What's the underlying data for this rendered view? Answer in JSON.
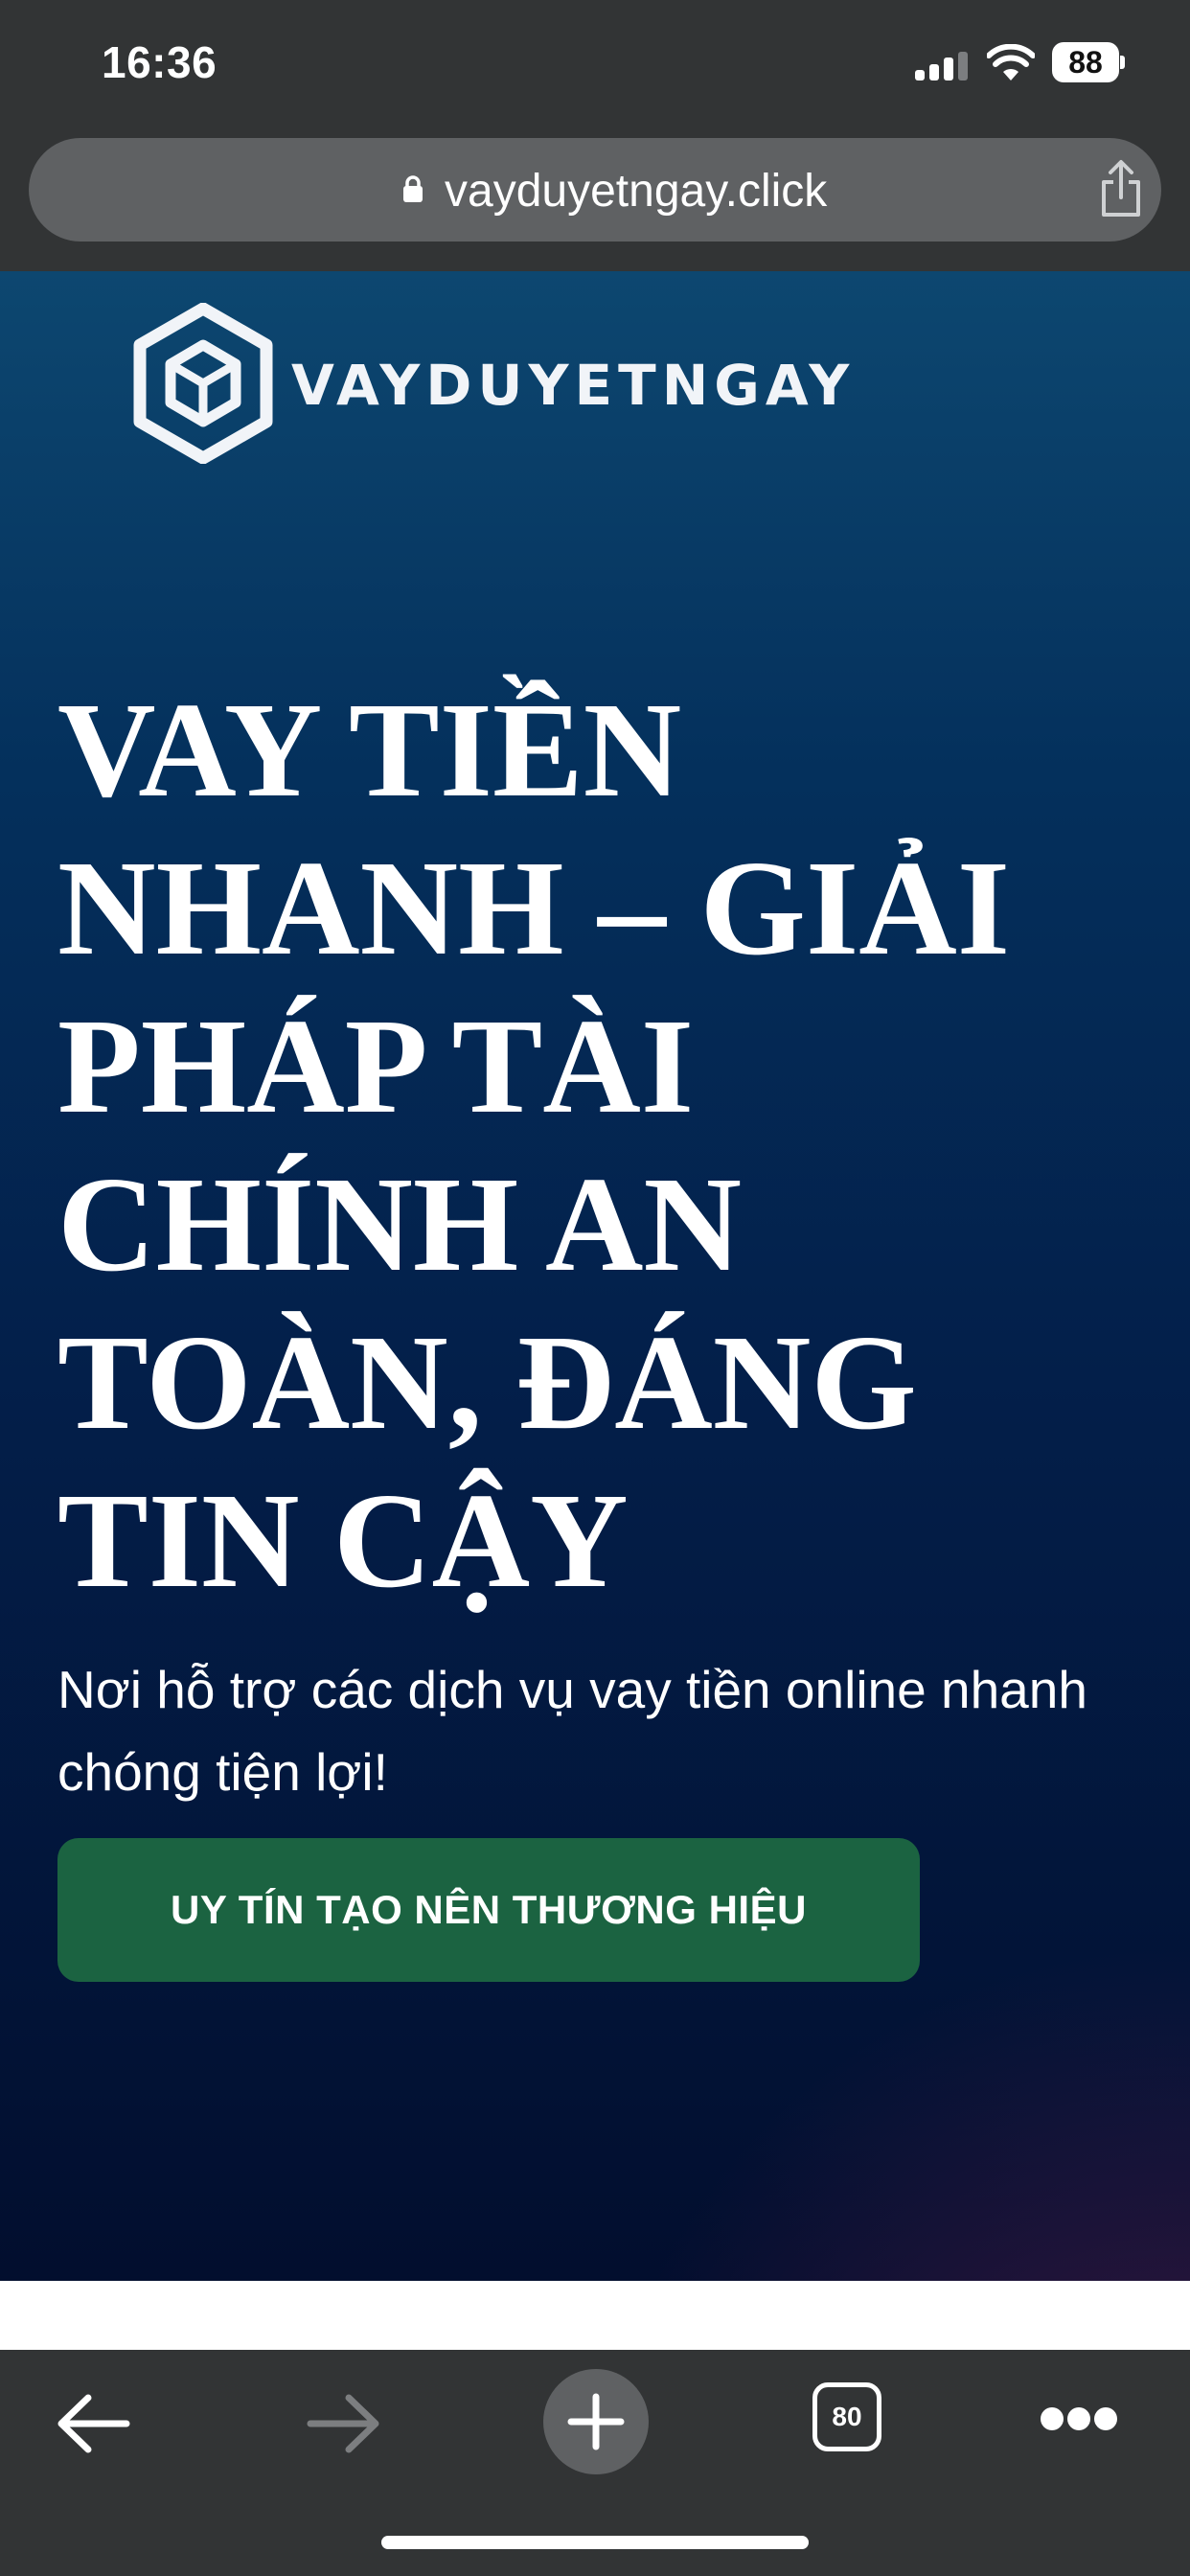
{
  "status_bar": {
    "time": "16:36",
    "battery": "88",
    "icons": [
      "signal-icon",
      "wifi-icon",
      "battery-icon"
    ]
  },
  "url_bar": {
    "url": "vayduyetngay.click",
    "icons": [
      "lock-icon",
      "share-icon"
    ]
  },
  "hero": {
    "logo_text": "VAYDUYETNGAY",
    "headline": "VAY TIỀN NHANH – GIẢI PHÁP TÀI CHÍNH AN TOÀN, ĐÁNG TIN CẬY",
    "subtitle": "Nơi hỗ trợ các dịch vụ vay tiền online nhanh chóng tiện lợi!",
    "cta_label": "UY TÍN TẠO NÊN THƯƠNG HIỆU"
  },
  "toolbar": {
    "tabs_count": "80",
    "icons": [
      "back-arrow-icon",
      "forward-arrow-icon",
      "plus-icon",
      "tabs-icon",
      "more-icon"
    ]
  },
  "colors": {
    "chrome": "#323435",
    "url_pill": "#5f6163",
    "hero_top": "#0d4770",
    "hero_bottom": "#020e2e",
    "cta_green": "#1b6341"
  }
}
